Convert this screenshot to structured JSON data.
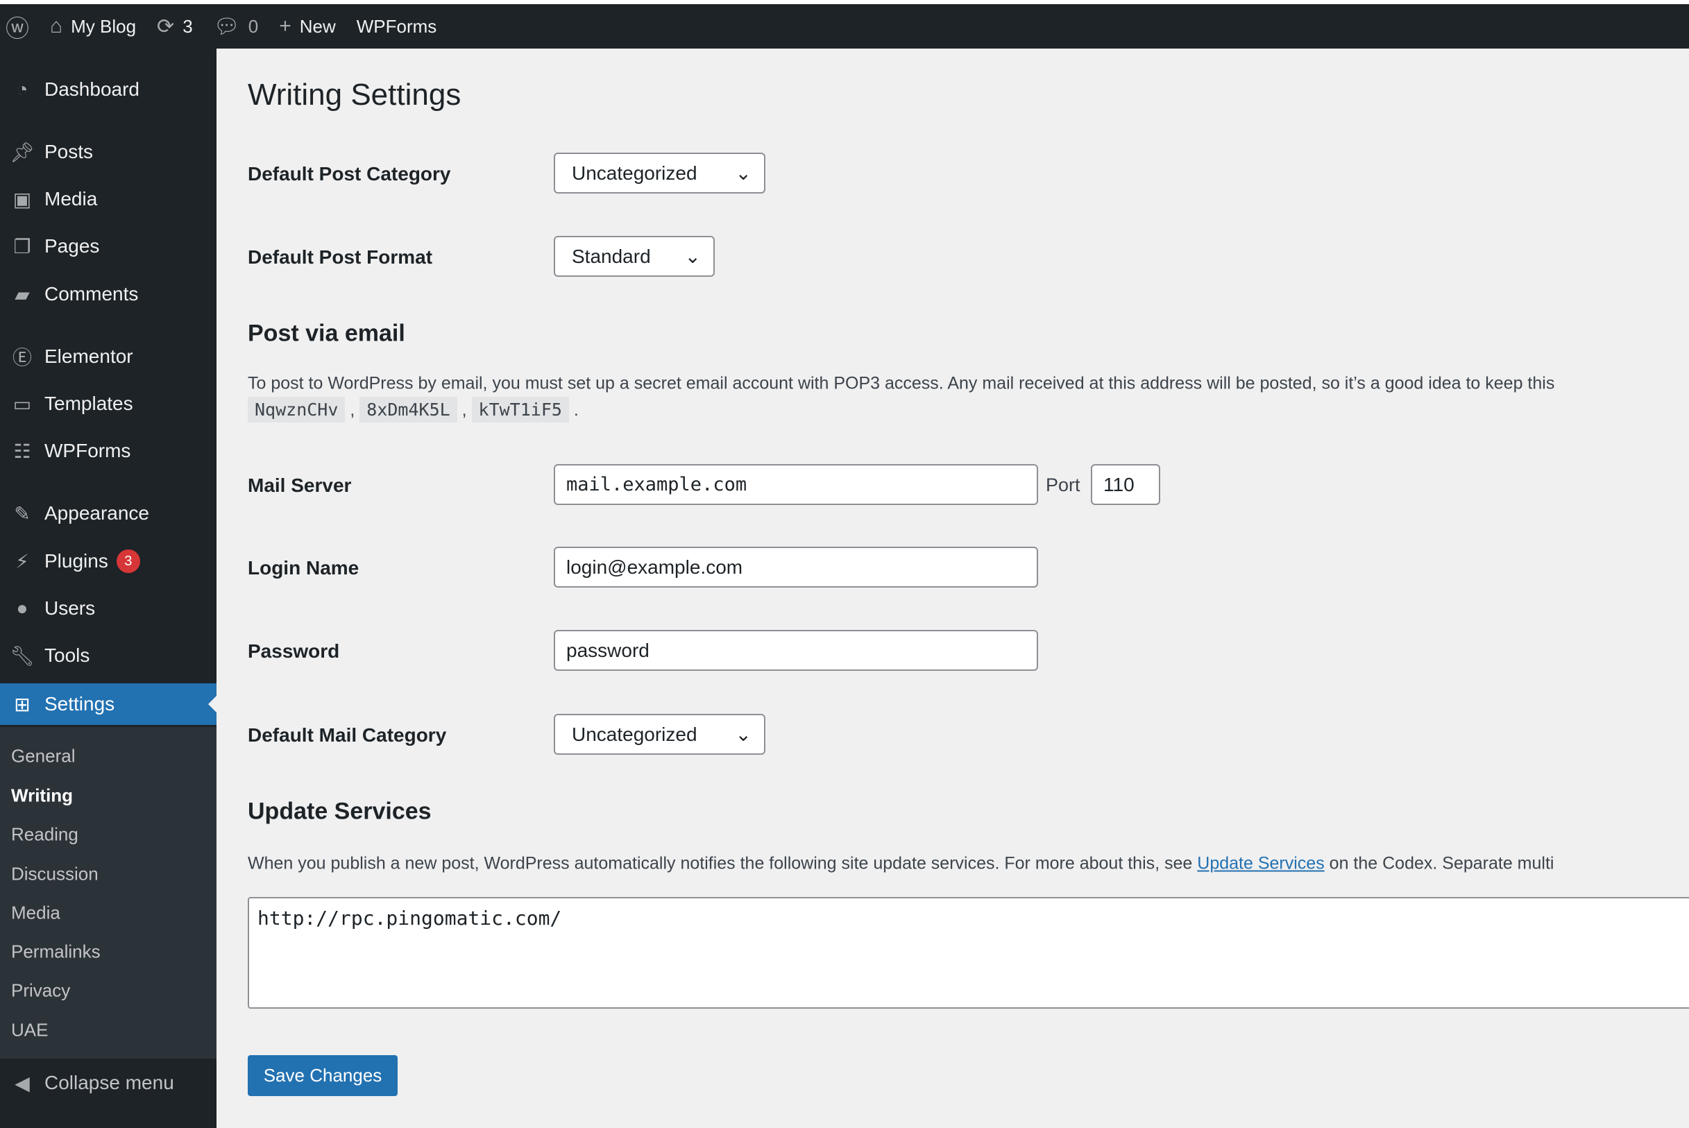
{
  "adminbar": {
    "site": "My Blog",
    "updates": "3",
    "comments": "0",
    "new": "New",
    "wpforms": "WPForms"
  },
  "sidebar": {
    "items": [
      {
        "label": "Dashboard",
        "icon": "dashboard-icon"
      },
      {
        "label": "Posts",
        "icon": "pin-icon"
      },
      {
        "label": "Media",
        "icon": "media-icon"
      },
      {
        "label": "Pages",
        "icon": "pages-icon"
      },
      {
        "label": "Comments",
        "icon": "comment-icon"
      },
      {
        "label": "Elementor",
        "icon": "elementor-icon"
      },
      {
        "label": "Templates",
        "icon": "folder-icon"
      },
      {
        "label": "WPForms",
        "icon": "form-icon"
      },
      {
        "label": "Appearance",
        "icon": "brush-icon"
      },
      {
        "label": "Plugins",
        "icon": "plug-icon",
        "badge": "3"
      },
      {
        "label": "Users",
        "icon": "user-icon"
      },
      {
        "label": "Tools",
        "icon": "wrench-icon"
      },
      {
        "label": "Settings",
        "icon": "settings-icon",
        "active": true
      }
    ],
    "submenu": [
      "General",
      "Writing",
      "Reading",
      "Discussion",
      "Media",
      "Permalinks",
      "Privacy",
      "UAE"
    ],
    "current_sub": "Writing",
    "collapse": "Collapse menu"
  },
  "page": {
    "title": "Writing Settings",
    "default_post_category": {
      "label": "Default Post Category",
      "value": "Uncategorized"
    },
    "default_post_format": {
      "label": "Default Post Format",
      "value": "Standard"
    },
    "post_via_email": {
      "heading": "Post via email",
      "text": "To post to WordPress by email, you must set up a secret email account with POP3 access. Any mail received at this address will be posted, so it’s a good idea to keep this",
      "codes": [
        "NqwznCHv",
        "8xDm4K5L",
        "kTwT1iF5"
      ]
    },
    "mail_server": {
      "label": "Mail Server",
      "value": "mail.example.com",
      "port_label": "Port",
      "port": "110"
    },
    "login_name": {
      "label": "Login Name",
      "value": "login@example.com"
    },
    "password": {
      "label": "Password",
      "value": "password"
    },
    "default_mail_category": {
      "label": "Default Mail Category",
      "value": "Uncategorized"
    },
    "update_services": {
      "heading": "Update Services",
      "text_before": "When you publish a new post, WordPress automatically notifies the following site update services. For more about this, see ",
      "link": "Update Services",
      "text_after": " on the Codex. Separate multi",
      "value": "http://rpc.pingomatic.com/"
    },
    "save": "Save Changes"
  }
}
